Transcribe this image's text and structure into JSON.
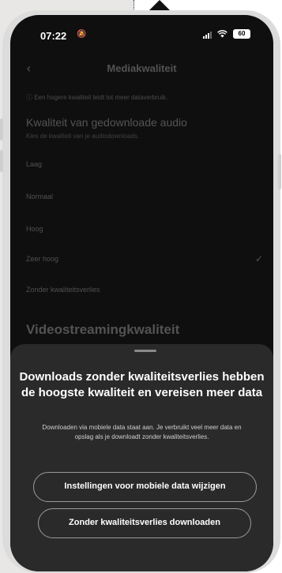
{
  "status_bar": {
    "time": "07:22",
    "battery": "60"
  },
  "nav": {
    "title": "Mediakwaliteit"
  },
  "info_note": "ⓘ Een hogere kwaliteit leidt tot meer dataverbruik.",
  "audio_section": {
    "heading": "Kwaliteit van gedownloade audio",
    "subtitle": "Kies de kwaliteit van je audiodownloads.",
    "options": [
      {
        "label": "Laag",
        "selected": false
      },
      {
        "label": "Normaal",
        "selected": false
      },
      {
        "label": "Hoog",
        "selected": false
      },
      {
        "label": "Zeer hoog",
        "selected": true
      },
      {
        "label": "Zonder kwaliteitsverlies",
        "selected": false
      }
    ]
  },
  "video_section": {
    "heading": "Videostreamingkwaliteit"
  },
  "sheet": {
    "title": "Downloads zonder kwaliteitsverlies hebben de hoogste kwaliteit en vereisen meer data",
    "body": "Downloaden via mobiele data staat aan. Je verbruikt veel meer data en opslag als je downloadt zonder kwaliteitsverlies.",
    "primary_button": "Instellingen voor mobiele data wijzigen",
    "secondary_button": "Zonder kwaliteitsverlies downloaden"
  },
  "colors": {
    "screen_bg": "#0f0f0f",
    "sheet_bg": "#2a2a2a",
    "button_border": "#9a9a9a"
  }
}
